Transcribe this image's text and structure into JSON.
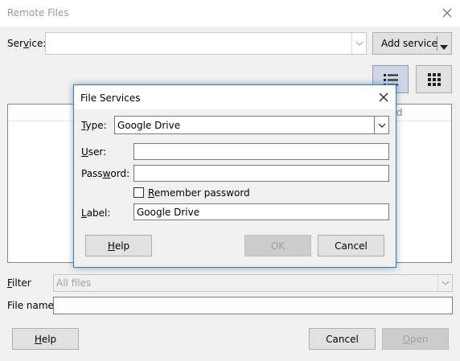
{
  "window": {
    "title": "Remote Files"
  },
  "service": {
    "label_pre": "Ser",
    "label_u": "v",
    "label_post": "ice:",
    "value": "",
    "add_button": "Add service"
  },
  "file_list": {
    "column_fragment": "d"
  },
  "filter": {
    "label_u": "F",
    "label_post": "ilter",
    "value": "All files"
  },
  "file_name": {
    "label": "File name",
    "value": ""
  },
  "footer": {
    "help_u": "H",
    "help_post": "elp",
    "cancel": "Cancel",
    "open_u": "O",
    "open_post": "pen"
  },
  "dialog": {
    "title": "File Services",
    "type_label_u": "T",
    "type_label_post": "ype:",
    "type_value": "Google Drive",
    "user_label_u": "U",
    "user_label_post": "ser:",
    "user_value": "",
    "password_label_pre": "Pass",
    "password_label_u": "w",
    "password_label_post": "ord:",
    "password_value": "",
    "remember_label_u": "R",
    "remember_label_post": "emember password",
    "remember_checked": false,
    "label_label_u": "L",
    "label_label_post": "abel:",
    "label_value": "Google Drive",
    "help_u": "H",
    "help_post": "elp",
    "ok": "OK",
    "cancel": "Cancel"
  },
  "icons": {
    "close": "close-icon",
    "dropdown": "chevron-down-icon",
    "list_view": "list-view-icon",
    "icon_view": "icon-view-icon"
  }
}
